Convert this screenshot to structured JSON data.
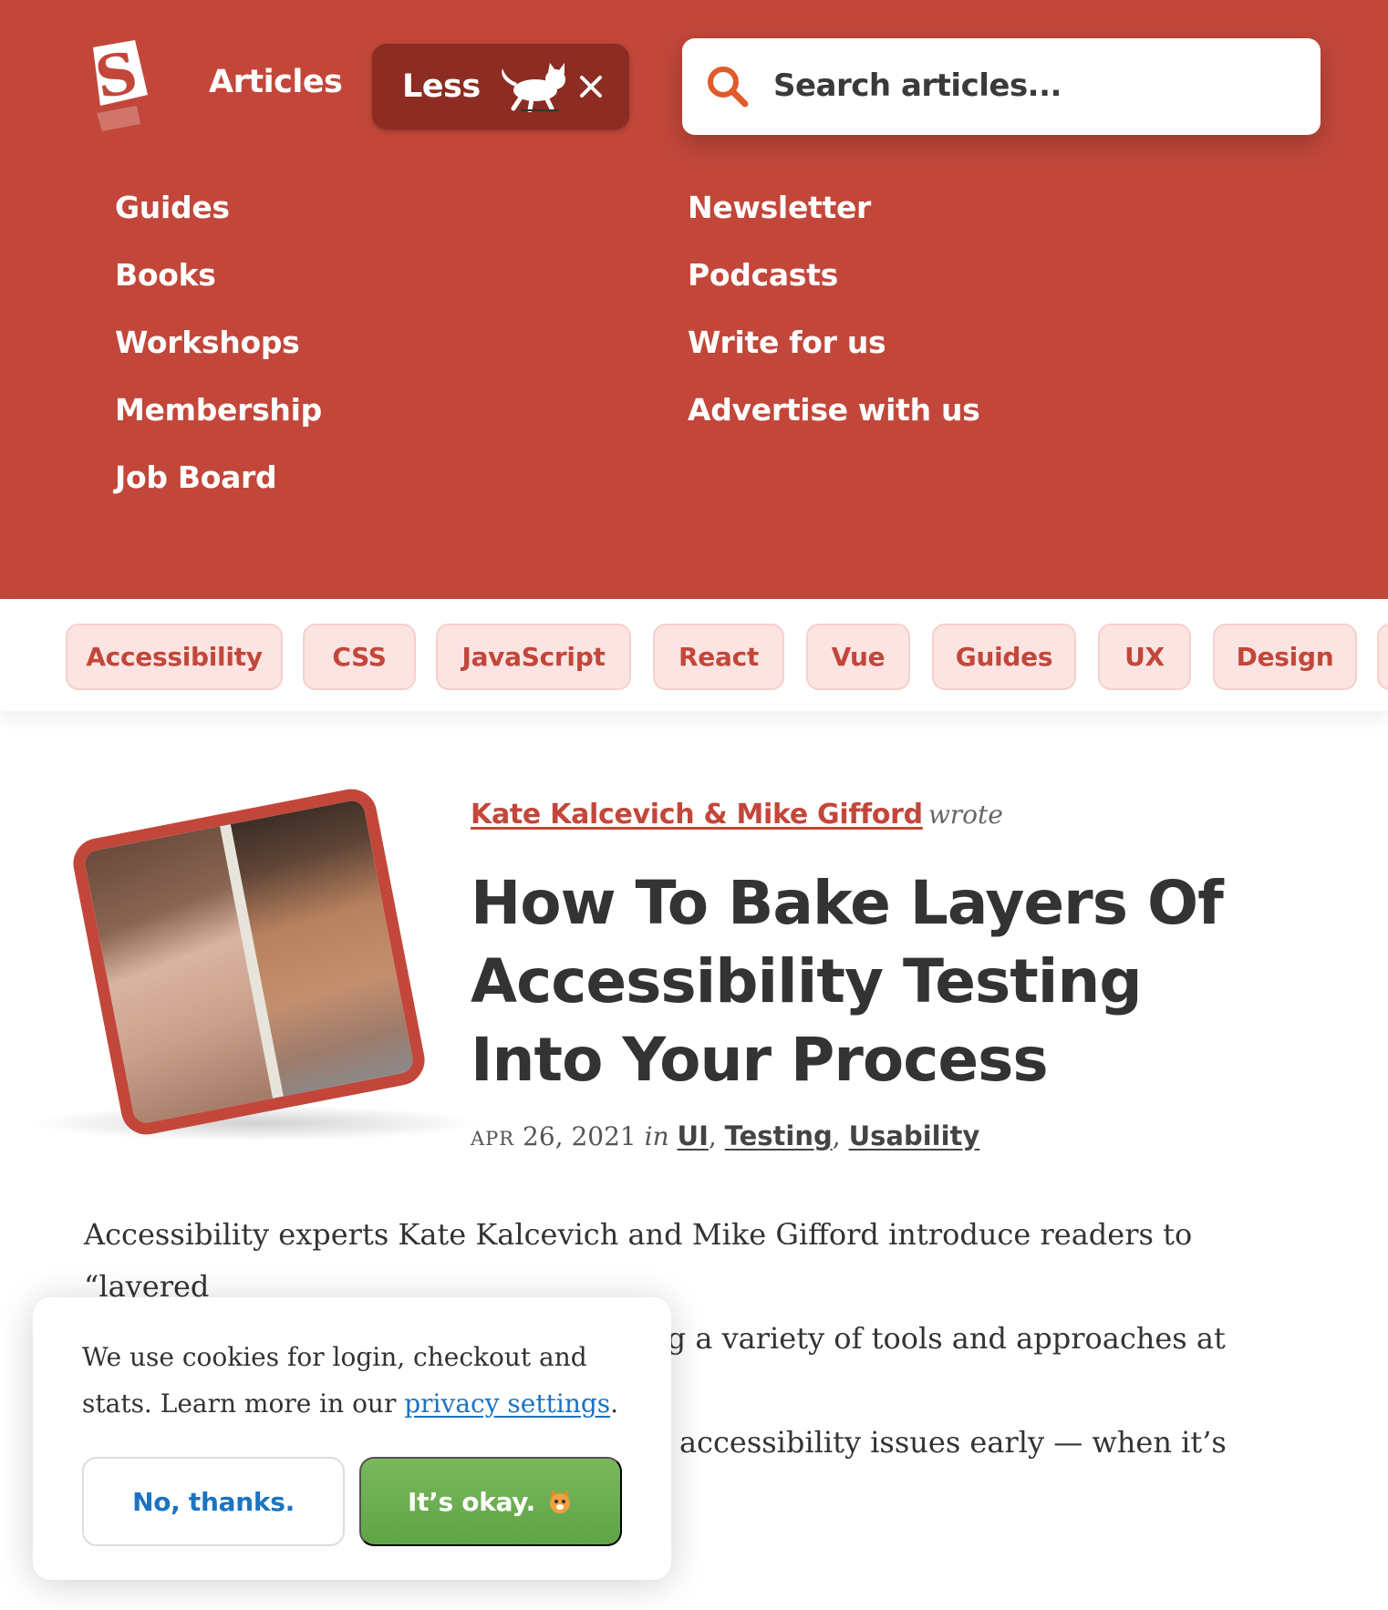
{
  "header": {
    "logo_letter": "S",
    "articles_label": "Articles",
    "less_label": "Less",
    "search_placeholder": "Search articles...",
    "menu_left": [
      "Guides",
      "Books",
      "Workshops",
      "Membership",
      "Job Board"
    ],
    "menu_right": [
      "Newsletter",
      "Podcasts",
      "Write for us",
      "Advertise with us"
    ]
  },
  "tags": [
    "Accessibility",
    "CSS",
    "JavaScript",
    "React",
    "Vue",
    "Guides",
    "UX",
    "Design"
  ],
  "article": {
    "authors": "Kate Kalcevich & Mike Gifford",
    "wrote": "wrote",
    "title": "How To Bake Layers Of Accessibility Testing Into Your Process",
    "date_month": "APR",
    "date_rest": "26, 2021",
    "in": "in",
    "categories": [
      "UI",
      "Testing",
      "Usability"
    ],
    "intro_line1": "Accessibility experts Kate Kalcevich and Mike Gifford introduce readers to “layered",
    "intro_line2": "accessibility testing”, a practice of using a variety of tools and approaches at different",
    "intro_line3": "stages of product development to catch accessibility issues early — when it’s easier"
  },
  "cookie": {
    "text_before": "We use cookies for login, checkout and stats. Learn more in our ",
    "link": "privacy settings",
    "text_after": ".",
    "no_label": "No, thanks.",
    "ok_label": "It’s okay."
  },
  "colors": {
    "brand": "#c2473a",
    "less_bg": "#8c2c22",
    "tag_bg": "#fce4e2",
    "link_blue": "#1c73c2",
    "ok_green": "#6aac4f"
  },
  "icons": [
    "smashing-logo",
    "cat-icon",
    "close-icon",
    "search-icon",
    "cat-face-icon"
  ]
}
